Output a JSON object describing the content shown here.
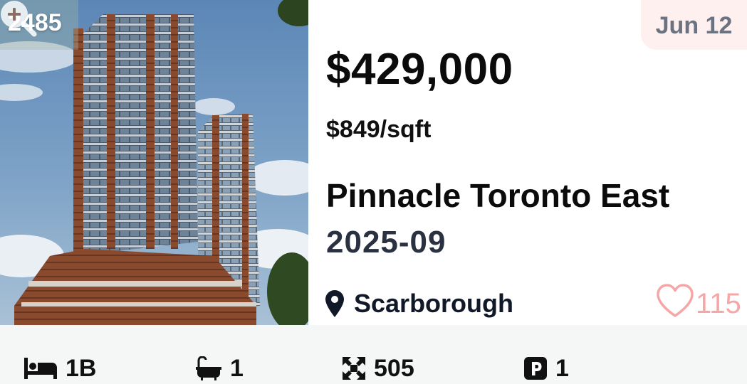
{
  "listing": {
    "id_label": "2485",
    "date": "Jun 12",
    "price": "$429,000",
    "price_per_sqft": "$849/sqft",
    "name": "Pinnacle Toronto East",
    "occupancy": "2025-09",
    "location": "Scarborough",
    "favorites": "115"
  },
  "features": {
    "beds": "1B",
    "baths": "1",
    "size": "505",
    "parking": "1"
  },
  "icons": {
    "zoom": "zoom-in-icon",
    "location": "map-pin-icon",
    "favorite": "heart-outline-icon",
    "beds": "bed-icon",
    "baths": "bathtub-icon",
    "size": "expand-arrows-icon",
    "parking": "parking-icon"
  },
  "colors": {
    "date_badge_bg": "#fdf0ef",
    "date_text": "#6b7280",
    "favorite": "#f6a6a6",
    "feature_bar_bg": "#f5f7f7"
  }
}
